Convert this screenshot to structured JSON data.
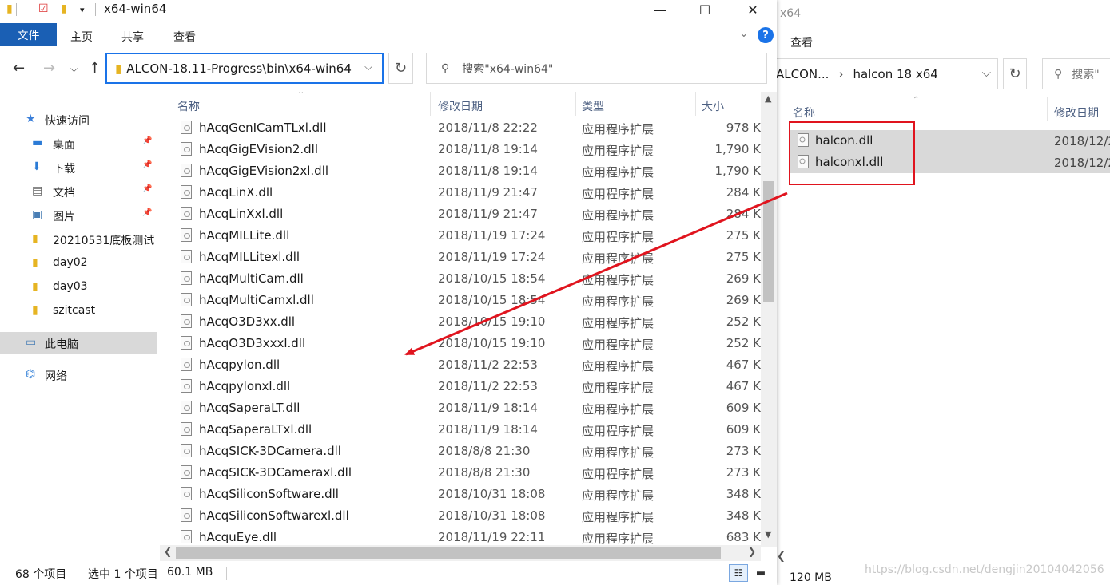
{
  "back_window": {
    "title": "x64",
    "tab_view": "查看",
    "address_segments": [
      "ALCON...",
      "halcon 18 x64"
    ],
    "search_placeholder": "搜索\"",
    "col_name": "名称",
    "col_date": "修改日期",
    "files": [
      {
        "name": "halcon.dll",
        "date": "2018/12/2"
      },
      {
        "name": "halconxl.dll",
        "date": "2018/12/2"
      }
    ],
    "status_size": "120 MB",
    "watermark": "https://blog.csdn.net/dengjin20104042056"
  },
  "window": {
    "title": "x64-win64",
    "ribbon": {
      "file": "文件",
      "home": "主页",
      "share": "共享",
      "view": "查看"
    },
    "address": "ALCON-18.11-Progress\\bin\\x64-win64",
    "search_placeholder": "搜索\"x64-win64\"",
    "sidebar": [
      {
        "label": "快速访问",
        "icon": "star-icon",
        "pinned": false,
        "top": true
      },
      {
        "label": "桌面",
        "icon": "desktop-icon",
        "pinned": true
      },
      {
        "label": "下载",
        "icon": "download-icon",
        "pinned": true
      },
      {
        "label": "文档",
        "icon": "document-icon",
        "pinned": true
      },
      {
        "label": "图片",
        "icon": "picture-icon",
        "pinned": true
      },
      {
        "label": "20210531底板测试",
        "icon": "folder-icon",
        "pinned": false
      },
      {
        "label": "day02",
        "icon": "folder-icon",
        "pinned": false
      },
      {
        "label": "day03",
        "icon": "folder-icon",
        "pinned": false
      },
      {
        "label": "szitcast",
        "icon": "folder-icon",
        "pinned": false
      },
      {
        "label": "此电脑",
        "icon": "computer-icon",
        "pinned": false,
        "top": true,
        "selected": true
      },
      {
        "label": "网络",
        "icon": "network-icon",
        "pinned": false,
        "top": true
      }
    ],
    "columns": {
      "name": "名称",
      "date": "修改日期",
      "type": "类型",
      "size": "大小"
    },
    "files": [
      {
        "name": "hAcqGenICamTLxl.dll",
        "date": "2018/11/8 22:22",
        "type": "应用程序扩展",
        "size": "978 K"
      },
      {
        "name": "hAcqGigEVision2.dll",
        "date": "2018/11/8 19:14",
        "type": "应用程序扩展",
        "size": "1,790 K"
      },
      {
        "name": "hAcqGigEVision2xl.dll",
        "date": "2018/11/8 19:14",
        "type": "应用程序扩展",
        "size": "1,790 K"
      },
      {
        "name": "hAcqLinX.dll",
        "date": "2018/11/9 21:47",
        "type": "应用程序扩展",
        "size": "284 K"
      },
      {
        "name": "hAcqLinXxl.dll",
        "date": "2018/11/9 21:47",
        "type": "应用程序扩展",
        "size": "284 K"
      },
      {
        "name": "hAcqMILLite.dll",
        "date": "2018/11/19 17:24",
        "type": "应用程序扩展",
        "size": "275 K"
      },
      {
        "name": "hAcqMILLitexl.dll",
        "date": "2018/11/19 17:24",
        "type": "应用程序扩展",
        "size": "275 K"
      },
      {
        "name": "hAcqMultiCam.dll",
        "date": "2018/10/15 18:54",
        "type": "应用程序扩展",
        "size": "269 K"
      },
      {
        "name": "hAcqMultiCamxl.dll",
        "date": "2018/10/15 18:54",
        "type": "应用程序扩展",
        "size": "269 K"
      },
      {
        "name": "hAcqO3D3xx.dll",
        "date": "2018/10/15 19:10",
        "type": "应用程序扩展",
        "size": "252 K"
      },
      {
        "name": "hAcqO3D3xxxl.dll",
        "date": "2018/10/15 19:10",
        "type": "应用程序扩展",
        "size": "252 K"
      },
      {
        "name": "hAcqpylon.dll",
        "date": "2018/11/2 22:53",
        "type": "应用程序扩展",
        "size": "467 K"
      },
      {
        "name": "hAcqpylonxl.dll",
        "date": "2018/11/2 22:53",
        "type": "应用程序扩展",
        "size": "467 K"
      },
      {
        "name": "hAcqSaperaLT.dll",
        "date": "2018/11/9 18:14",
        "type": "应用程序扩展",
        "size": "609 K"
      },
      {
        "name": "hAcqSaperaLTxl.dll",
        "date": "2018/11/9 18:14",
        "type": "应用程序扩展",
        "size": "609 K"
      },
      {
        "name": "hAcqSICK-3DCamera.dll",
        "date": "2018/8/8 21:30",
        "type": "应用程序扩展",
        "size": "273 K"
      },
      {
        "name": "hAcqSICK-3DCameraxl.dll",
        "date": "2018/8/8 21:30",
        "type": "应用程序扩展",
        "size": "273 K"
      },
      {
        "name": "hAcqSiliconSoftware.dll",
        "date": "2018/10/31 18:08",
        "type": "应用程序扩展",
        "size": "348 K"
      },
      {
        "name": "hAcqSiliconSoftwarexl.dll",
        "date": "2018/10/31 18:08",
        "type": "应用程序扩展",
        "size": "348 K"
      },
      {
        "name": "hAcquEye.dll",
        "date": "2018/11/19 22:11",
        "type": "应用程序扩展",
        "size": "683 K"
      }
    ],
    "status": {
      "count": "68 个项目",
      "selected": "选中 1 个项目",
      "size": "60.1 MB"
    }
  },
  "colors": {
    "accent": "#1a5fb4",
    "selection": "#d9d9d9",
    "annotation": "#e0141e"
  }
}
